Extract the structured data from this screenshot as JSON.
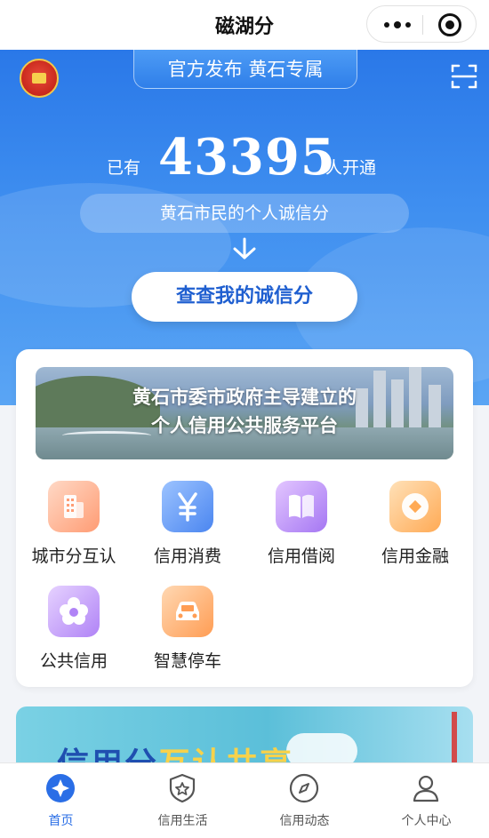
{
  "app": {
    "title": "磁湖分"
  },
  "hero": {
    "tag": "官方发布 黄石专属",
    "stat_prefix": "已有",
    "stat_number": "43395",
    "stat_suffix": "人开通",
    "subtitle": "黄石市民的个人诚信分",
    "button_label": "查查我的诚信分"
  },
  "card": {
    "banner_line1": "黄石市委市政府主导建立的",
    "banner_line2": "个人信用公共服务平台",
    "services": [
      {
        "label": "城市分互认",
        "icon": "building-icon",
        "color": "#ff9c74"
      },
      {
        "label": "信用消费",
        "icon": "yen-icon",
        "color": "#4b86f0"
      },
      {
        "label": "信用借阅",
        "icon": "book-icon",
        "color": "#a577f3"
      },
      {
        "label": "信用金融",
        "icon": "coin-icon",
        "color": "#ffaa55"
      },
      {
        "label": "公共信用",
        "icon": "flower-icon",
        "color": "#b083f6"
      },
      {
        "label": "智慧停车",
        "icon": "car-icon",
        "color": "#ff9d54"
      }
    ]
  },
  "promo": {
    "text_part1": "信用分",
    "text_part2": "互认共享"
  },
  "tabbar": {
    "tabs": [
      {
        "label": "首页",
        "icon": "home-icon",
        "active": true
      },
      {
        "label": "信用生活",
        "icon": "shield-star-icon",
        "active": false
      },
      {
        "label": "信用动态",
        "icon": "compass-icon",
        "active": false
      },
      {
        "label": "个人中心",
        "icon": "person-icon",
        "active": false
      }
    ]
  },
  "colors": {
    "primary": "#2a6ee6",
    "hero_top": "#2a78e8",
    "button_text": "#1f5fd0"
  }
}
